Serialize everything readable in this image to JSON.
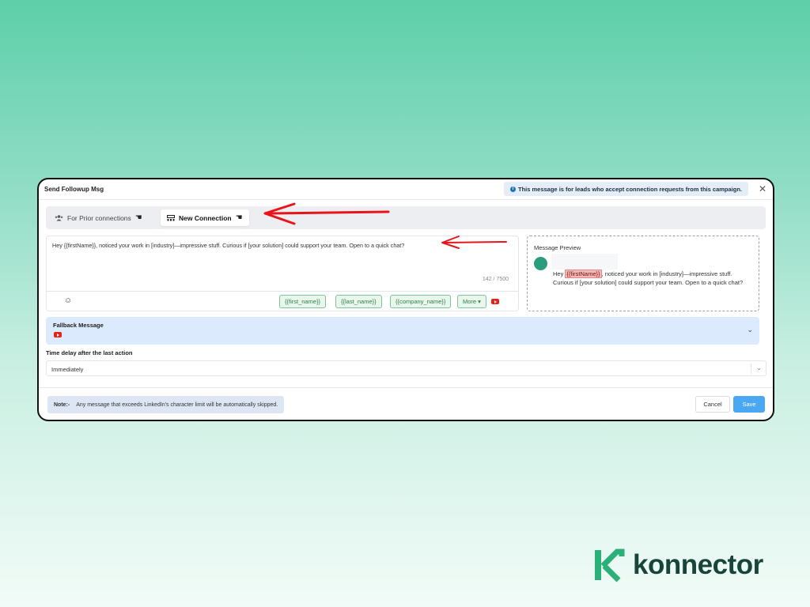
{
  "modal": {
    "title": "Send Followup Msg",
    "info_banner": "This message is for leads who accept connection requests from this campaign.",
    "close_glyph": "✕"
  },
  "tabs": [
    {
      "label": "For Prior connections",
      "icon": "users-icon",
      "active": false
    },
    {
      "label": "New Connection",
      "icon": "new-connection-icon",
      "active": true
    }
  ],
  "editor": {
    "text": "Hey {{firstName}}, noticed your work in [industry]—impressive stuff. Curious if [your solution] could support your team. Open to a quick chat?",
    "char_count": "142 / 7500",
    "variables": [
      "{{first_name}}",
      "{{last_name}}",
      "{{company_name}}"
    ],
    "more_label": "More ▾"
  },
  "preview": {
    "title": "Message Preview",
    "text_before": "Hey ",
    "highlight": "{{firstName}}",
    "text_after": ", noticed your work in [industry]—impressive stuff. Curious if [your solution] could support your team. Open to a quick chat?"
  },
  "fallback": {
    "title": "Fallback Message"
  },
  "delay": {
    "label": "Time delay after the last action",
    "value": "Immediately"
  },
  "footer": {
    "note_label": "Note:-",
    "note_text": "Any message that exceeds LinkedIn's character limit will be automatically skipped.",
    "cancel_label": "Cancel",
    "save_label": "Save"
  },
  "brand": {
    "name": "konnector",
    "color": "#17453a",
    "accent": "#2bb07a"
  },
  "colors": {
    "accent": "#4aa8f2",
    "arrow": "#e8141a"
  }
}
